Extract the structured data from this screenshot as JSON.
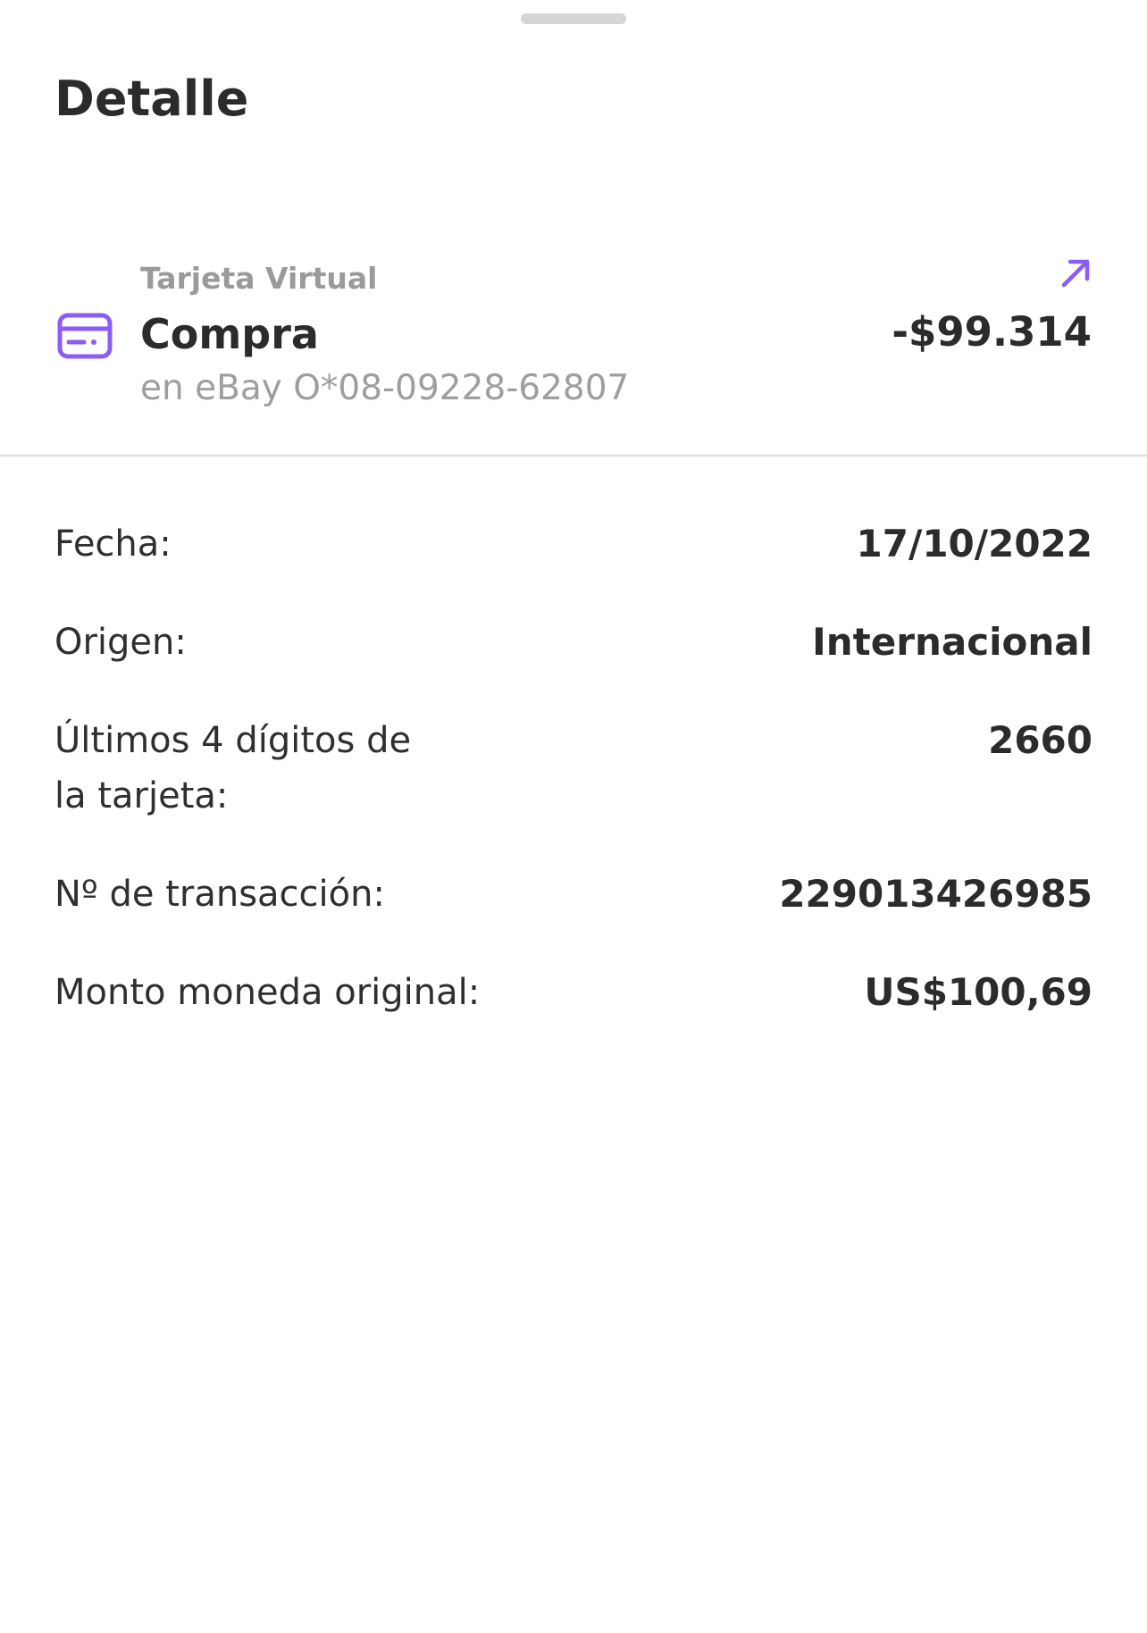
{
  "sheet": {
    "title": "Detalle"
  },
  "transaction": {
    "source": "Tarjeta Virtual",
    "type": "Compra",
    "merchant": "en eBay O*08-09228-62807",
    "amount": "-$99.314",
    "direction_icon": "arrow-up-right-icon",
    "card_icon": "credit-card-icon",
    "accent_color": "#8B5CF6"
  },
  "details": [
    {
      "label": "Fecha:",
      "value": "17/10/2022"
    },
    {
      "label": "Origen:",
      "value": "Internacional"
    },
    {
      "label": "Últimos 4 dígitos de la tarjeta:",
      "value": "2660"
    },
    {
      "label": "Nº de transacción:",
      "value": "229013426985"
    },
    {
      "label": "Monto moneda original:",
      "value": "US$100,69"
    }
  ]
}
